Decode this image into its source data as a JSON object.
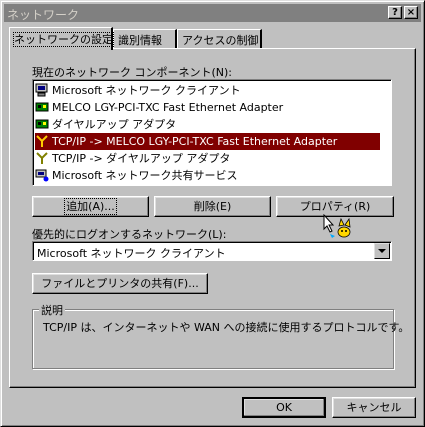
{
  "window": {
    "title": "ネットワーク",
    "help_button": "?",
    "close_button": "×"
  },
  "tabs": [
    {
      "label": "ネットワークの設定",
      "active": true
    },
    {
      "label": "識別情報",
      "active": false
    },
    {
      "label": "アクセスの制御",
      "active": false
    }
  ],
  "components": {
    "label": "現在のネットワーク コンポーネント(N):",
    "items": [
      {
        "label": "Microsoft ネットワーク クライアント",
        "icon": "client-icon",
        "selected": false
      },
      {
        "label": "MELCO LGY-PCI-TXC Fast Ethernet Adapter",
        "icon": "adapter-icon",
        "selected": false
      },
      {
        "label": "ダイヤルアップ アダプタ",
        "icon": "adapter-icon",
        "selected": false
      },
      {
        "label": "TCP/IP -> MELCO LGY-PCI-TXC Fast Ethernet Adapter",
        "icon": "protocol-icon",
        "selected": true
      },
      {
        "label": "TCP/IP -> ダイヤルアップ アダプタ",
        "icon": "protocol-icon",
        "selected": false
      },
      {
        "label": "Microsoft ネットワーク共有サービス",
        "icon": "service-icon",
        "selected": false
      }
    ]
  },
  "buttons": {
    "add": "追加(A)...",
    "remove": "削除(E)",
    "properties": "プロパティ(R)",
    "file_share": "ファイルとプリンタの共有(F)...",
    "ok": "OK",
    "cancel": "キャンセル"
  },
  "primary_logon": {
    "label": "優先的にログオンするネットワーク(L):",
    "value": "Microsoft ネットワーク クライアント"
  },
  "description": {
    "title": "説明",
    "text": "TCP/IP は、インターネットや WAN への接続に使用するプロトコルです。"
  },
  "colors": {
    "face": "#c0c0c0",
    "selection": "#800000",
    "titlebar_inactive": "#808080"
  }
}
